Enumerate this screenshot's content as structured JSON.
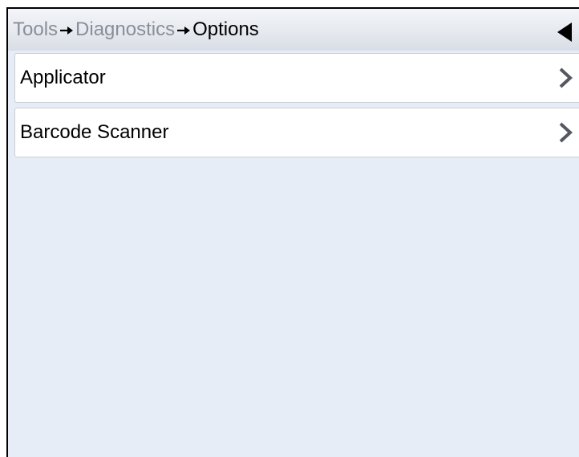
{
  "breadcrumb": {
    "items": [
      "Tools",
      "Diagnostics",
      "Options"
    ]
  },
  "header": {
    "back_icon": "back-triangle-icon"
  },
  "list": {
    "items": [
      {
        "label": "Applicator",
        "icon": "chevron-right-icon"
      },
      {
        "label": "Barcode Scanner",
        "icon": "chevron-right-icon"
      }
    ]
  },
  "colors": {
    "background": "#e7edf6",
    "item_background": "#ffffff",
    "breadcrumb_inactive": "#8a8e96",
    "breadcrumb_active": "#000000"
  }
}
